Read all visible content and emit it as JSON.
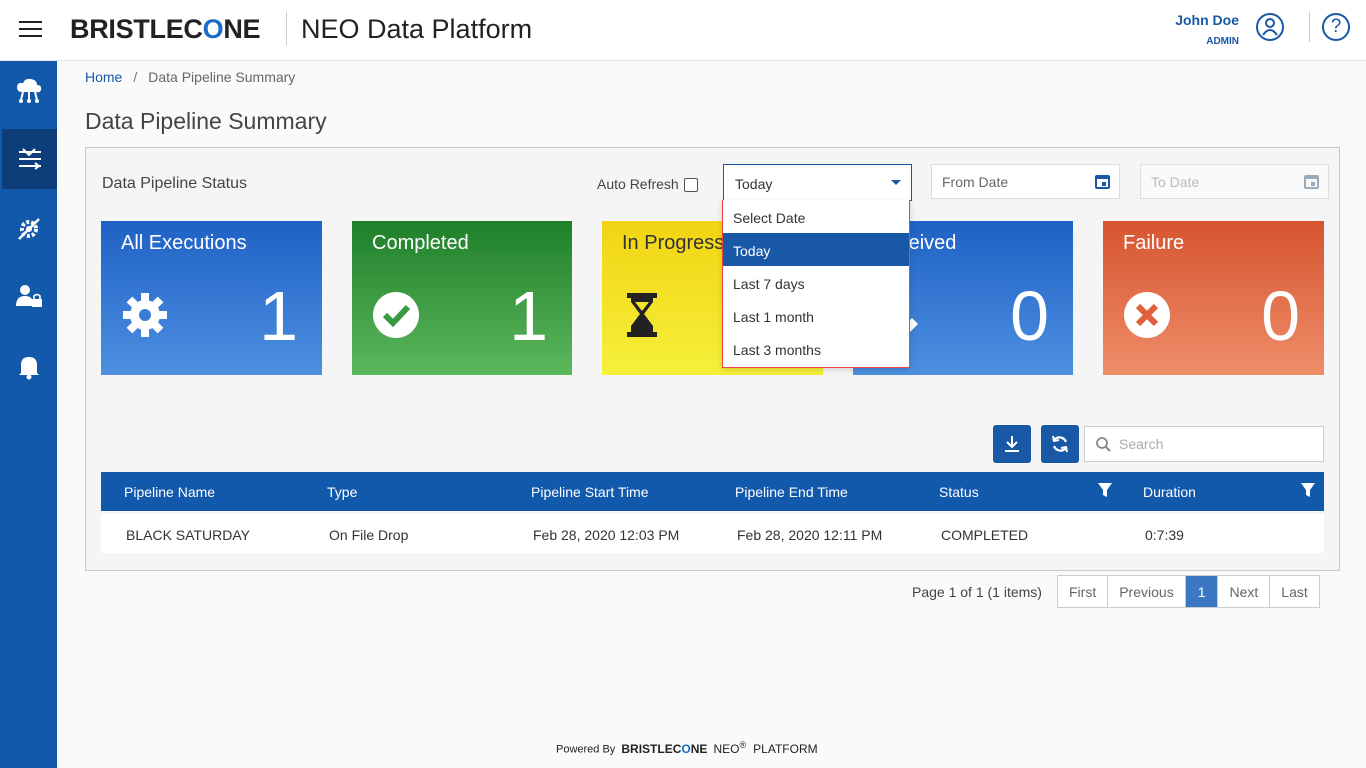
{
  "header": {
    "brand": "BRISTLECONE",
    "platform_title": "NEO Data Platform",
    "user_name": "John Doe",
    "user_role": "ADMIN"
  },
  "sidebar": {
    "items": [
      {
        "icon": "cloud-network-icon"
      },
      {
        "icon": "pipeline-icon",
        "active": true
      },
      {
        "icon": "settings-tools-icon"
      },
      {
        "icon": "user-lock-icon"
      },
      {
        "icon": "bell-icon"
      }
    ]
  },
  "breadcrumb": {
    "home": "Home",
    "separator": "/",
    "current": "Data Pipeline Summary"
  },
  "page_title": "Data Pipeline Summary",
  "panel": {
    "title": "Data Pipeline Status",
    "auto_refresh_label": "Auto Refresh",
    "date_select": {
      "value": "Today",
      "options": [
        "Select Date",
        "Today",
        "Last 7 days",
        "Last 1 month",
        "Last 3 months"
      ],
      "selected_index": 1
    },
    "from_date_placeholder": "From Date",
    "to_date_placeholder": "To Date"
  },
  "tiles": [
    {
      "title": "All Executions",
      "count": "1",
      "icon": "gear-icon",
      "color": "#1f62c6"
    },
    {
      "title": "Completed",
      "count": "1",
      "icon": "check-circle-icon",
      "color": "#1f7f2a"
    },
    {
      "title": "In Progress",
      "count": "",
      "icon": "hourglass-icon",
      "color": "#f2d413"
    },
    {
      "title": "Received",
      "count": "0",
      "icon": "received-icon",
      "color": "#1f62c6"
    },
    {
      "title": "Failure",
      "count": "0",
      "icon": "x-circle-icon",
      "color": "#d65530"
    }
  ],
  "search": {
    "placeholder": "Search"
  },
  "table": {
    "columns": [
      "Pipeline Name",
      "Type",
      "Pipeline Start Time",
      "Pipeline End Time",
      "Status",
      "Duration"
    ],
    "rows": [
      [
        "BLACK SATURDAY",
        "On File Drop",
        "Feb 28, 2020 12:03 PM",
        "Feb 28, 2020 12:11 PM",
        "COMPLETED",
        "0:7:39"
      ]
    ]
  },
  "pagination": {
    "info": "Page 1 of 1 (1 items)",
    "first": "First",
    "previous": "Previous",
    "current": "1",
    "next": "Next",
    "last": "Last"
  },
  "footer": {
    "powered_by": "Powered By",
    "brand": "BRISTLECONE",
    "neo": "NEO",
    "reg": "®",
    "platform": "PLATFORM"
  }
}
